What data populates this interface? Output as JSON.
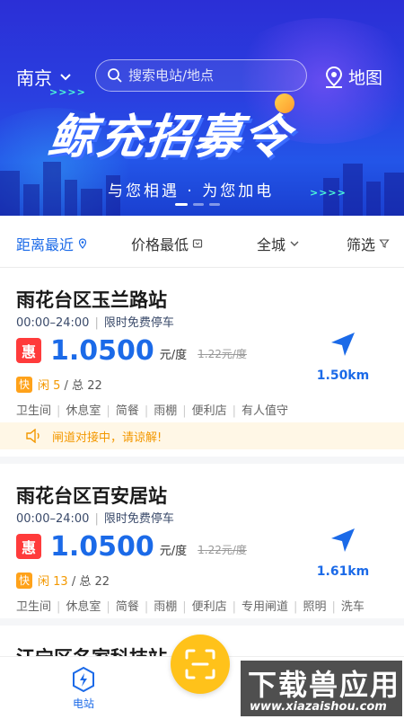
{
  "header": {
    "city": "南京",
    "search_placeholder": "搜索电站/地点",
    "map_label": "地图"
  },
  "banner": {
    "title": "鲸充招募令",
    "subtitle": "与您相遇 · 为您加电",
    "arrows": ">>>>"
  },
  "filters": [
    {
      "label": "距离最近",
      "active": true
    },
    {
      "label": "价格最低",
      "active": false
    },
    {
      "label": "全城",
      "active": false
    },
    {
      "label": "筛选",
      "active": false
    }
  ],
  "stations": [
    {
      "name": "雨花台区玉兰路站",
      "hours": "00:00–24:00",
      "parking": "限时免费停车",
      "discount_badge": "惠",
      "price": "1.0500",
      "unit": "元/度",
      "original_price": "1.22元/度",
      "fast_badge": "快",
      "idle_label": "闲 5",
      "total_label": "/ 总 22",
      "amenities": [
        "卫生间",
        "休息室",
        "简餐",
        "雨棚",
        "便利店",
        "有人值守"
      ],
      "distance": "1.50km",
      "notice": "闸道对接中，请谅解!"
    },
    {
      "name": "雨花台区百安居站",
      "hours": "00:00–24:00",
      "parking": "限时免费停车",
      "discount_badge": "惠",
      "price": "1.0500",
      "unit": "元/度",
      "original_price": "1.22元/度",
      "fast_badge": "快",
      "idle_label": "闲 13",
      "total_label": "/ 总 22",
      "amenities": [
        "卫生间",
        "休息室",
        "简餐",
        "雨棚",
        "便利店",
        "专用闸道",
        "照明",
        "洗车"
      ],
      "distance": "1.61km"
    },
    {
      "name": "江宁区名家科技站"
    }
  ],
  "bottom_nav": {
    "station_label": "电站"
  },
  "watermark": {
    "line1": "下载兽应用",
    "line2": "www.xiazaishou.com"
  },
  "colors": {
    "accent": "#1b6ae8",
    "discount": "#ff3b3b",
    "fast": "#ffa21a",
    "scan": "#ffc21a",
    "banner": "#2a3fe0"
  }
}
